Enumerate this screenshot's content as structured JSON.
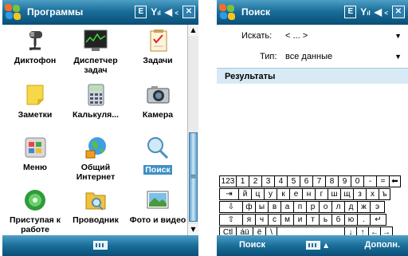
{
  "left_screen": {
    "title": "Программы",
    "status": {
      "e_icon": "E",
      "signal": "Y",
      "close": "✕"
    },
    "programs": [
      {
        "label": "Диктофон",
        "icon": "microphone-icon"
      },
      {
        "label": "Диспетчер задач",
        "icon": "task-manager-icon"
      },
      {
        "label": "Задачи",
        "icon": "tasks-icon"
      },
      {
        "label": "Заметки",
        "icon": "notes-icon"
      },
      {
        "label": "Калькуля...",
        "icon": "calculator-icon"
      },
      {
        "label": "Камера",
        "icon": "camera-icon"
      },
      {
        "label": "Меню",
        "icon": "menu-icon"
      },
      {
        "label": "Общий Интернет",
        "icon": "internet-sharing-icon"
      },
      {
        "label": "Поиск",
        "icon": "search-icon",
        "selected": true
      },
      {
        "label": "Приступая к работе",
        "icon": "getting-started-icon"
      },
      {
        "label": "Проводник",
        "icon": "explorer-icon"
      },
      {
        "label": "Фото и видео",
        "icon": "photos-icon"
      }
    ],
    "scrollbar": {
      "up": "▲",
      "down": "▼",
      "thumb": "≡"
    }
  },
  "right_screen": {
    "title": "Поиск",
    "status": {
      "e_icon": "E",
      "signal": "Y",
      "close": "✕"
    },
    "search_label": "Искать:",
    "search_value": "< ... >",
    "type_label": "Тип:",
    "type_value": "все данные",
    "results_label": "Результаты",
    "keyboard": {
      "rows": [
        [
          "123",
          "1",
          "2",
          "3",
          "4",
          "5",
          "6",
          "7",
          "8",
          "9",
          "0",
          "-",
          "=",
          "⬅"
        ],
        [
          "⇥",
          "й",
          "ц",
          "у",
          "к",
          "е",
          "н",
          "г",
          "ш",
          "щ",
          "з",
          "х",
          "ъ"
        ],
        [
          "⇩",
          "ф",
          "ы",
          "в",
          "а",
          "п",
          "р",
          "о",
          "л",
          "д",
          "ж",
          "э"
        ],
        [
          "⇧",
          "я",
          "ч",
          "с",
          "м",
          "и",
          "т",
          "ь",
          "б",
          "ю",
          ".",
          "↵"
        ],
        [
          "Ctl",
          "áü",
          "ё",
          "\\",
          "",
          "↓",
          "↑",
          "←",
          "→"
        ]
      ]
    },
    "menu_left": "Поиск",
    "menu_right": "Дополн."
  },
  "colors": {
    "titlebar": "#1a6e99",
    "selection": "#3d8fc4",
    "results_header": "#d7eaf5"
  }
}
